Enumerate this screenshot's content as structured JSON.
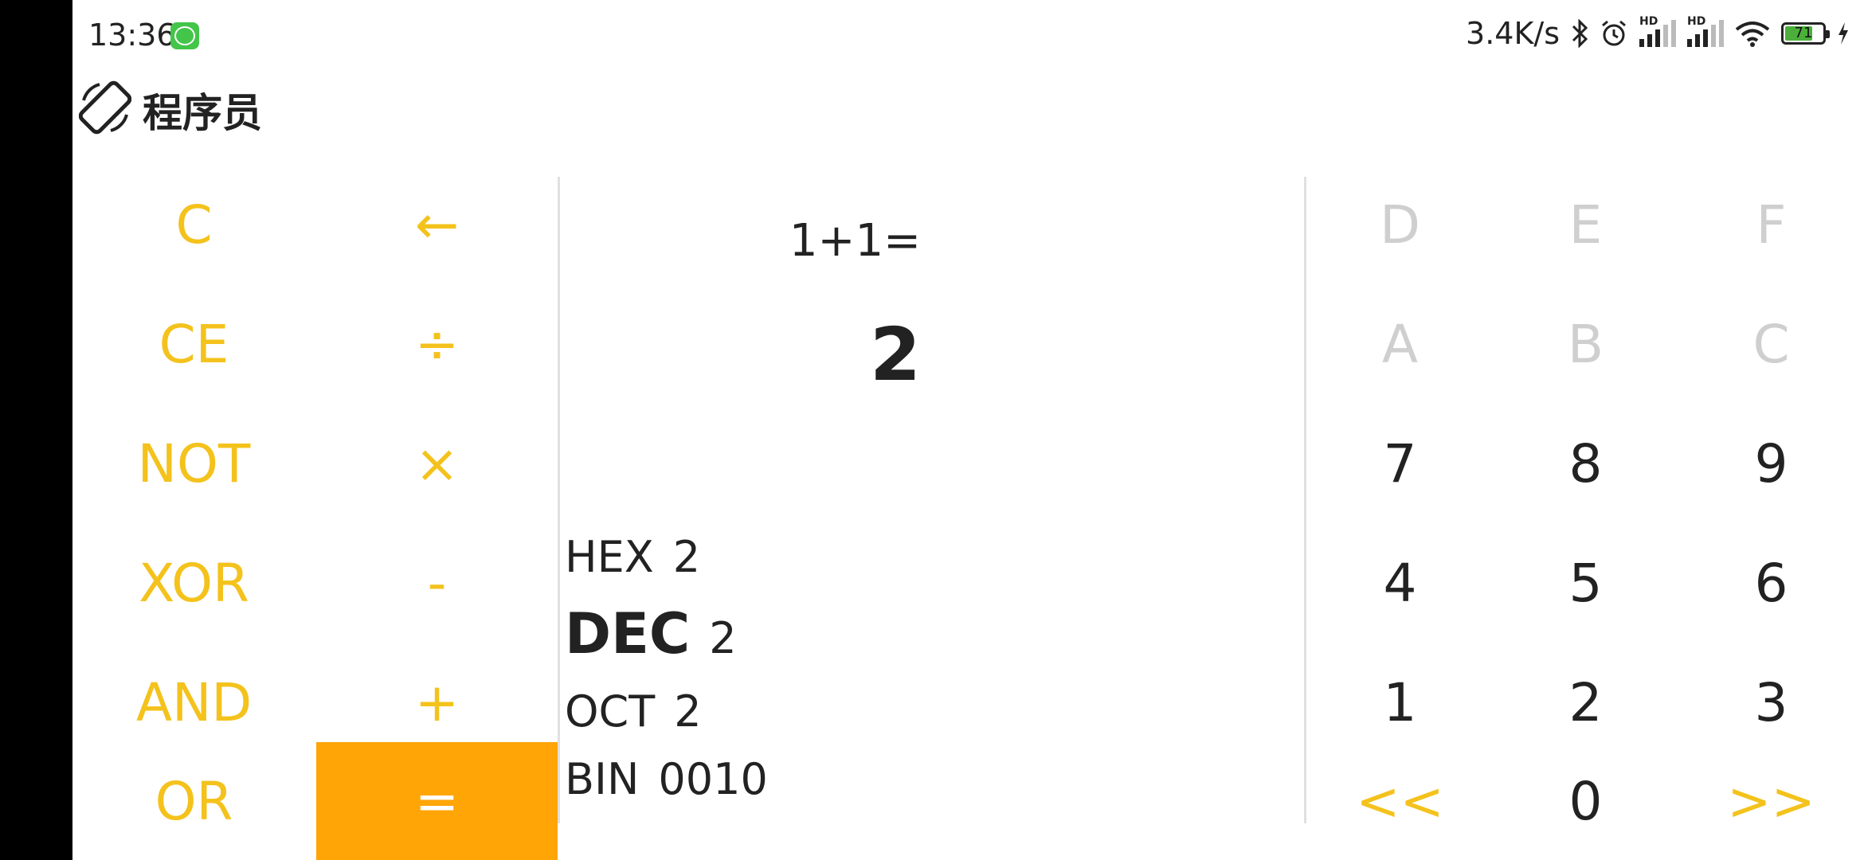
{
  "status_bar": {
    "time": "13:36",
    "net_speed": "3.4K/s",
    "hd1": "HD",
    "hd2": "HD",
    "battery_level": "71",
    "notification_app_color": "#43c54a",
    "icons": [
      "bluetooth-icon",
      "alarm-icon",
      "signal-icon",
      "signal-icon",
      "wifi-icon",
      "battery-icon",
      "charging-icon"
    ]
  },
  "header": {
    "title": "程序员",
    "mode_icon": "screen-rotate-icon"
  },
  "left_keys": {
    "clear": "C",
    "backspace": "←",
    "clear_entry": "CE",
    "divide": "÷",
    "not": "NOT",
    "multiply": "×",
    "xor": "XOR",
    "minus": "-",
    "and": "AND",
    "plus": "+",
    "or": "OR",
    "equals": "="
  },
  "display": {
    "expression": "1+1=",
    "result": "2"
  },
  "bases": {
    "hex": {
      "label": "HEX",
      "value": "2"
    },
    "dec": {
      "label": "DEC",
      "value": "2"
    },
    "oct": {
      "label": "OCT",
      "value": "2"
    },
    "bin": {
      "label": "BIN",
      "value": "0010"
    }
  },
  "right_keys": {
    "d": "D",
    "e": "E",
    "f": "F",
    "a": "A",
    "b": "B",
    "c": "C",
    "k7": "7",
    "k8": "8",
    "k9": "9",
    "k4": "4",
    "k5": "5",
    "k6": "6",
    "k1": "1",
    "k2": "2",
    "k3": "3",
    "shl": "<<",
    "k0": "0",
    "shr": ">>"
  },
  "colors": {
    "accent": "#f4c21c",
    "equals_bg": "#ffa506",
    "disabled": "#cfcfcf",
    "text": "#222222"
  }
}
